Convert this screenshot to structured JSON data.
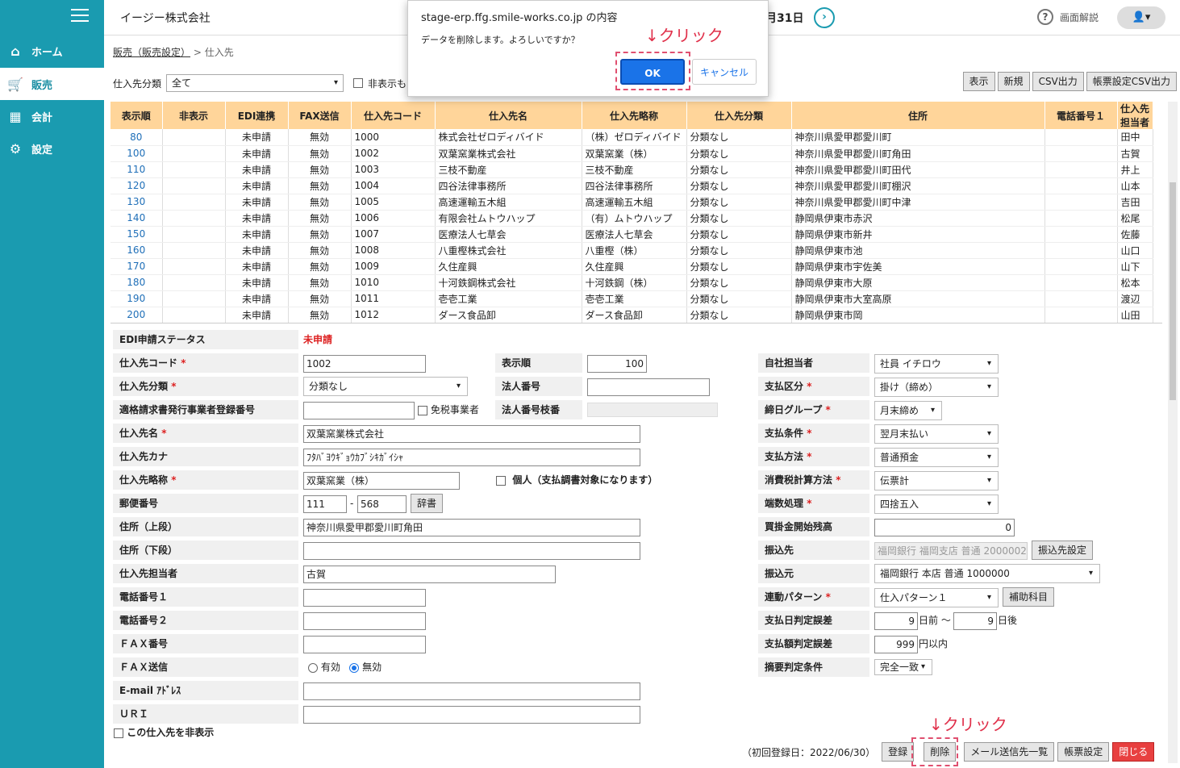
{
  "sidebar": {
    "items": [
      {
        "icon": "home-icon",
        "label": "ホーム"
      },
      {
        "icon": "cart-icon",
        "label": "販売"
      },
      {
        "icon": "calculator-icon",
        "label": "会計"
      },
      {
        "icon": "gear-icon",
        "label": "設定"
      }
    ]
  },
  "header": {
    "company": "イージー株式会社",
    "date_fragment": "月31日",
    "help_label": "画面解説"
  },
  "breadcrumb": {
    "parent": "販売（販売設定）",
    "current": "仕入先"
  },
  "filter": {
    "label": "仕入先分類",
    "value": "全て",
    "hidden_label": "非表示も"
  },
  "toolbar": {
    "show": "表示",
    "new": "新規",
    "csv": "CSV出力",
    "form_csv": "帳票設定CSV出力"
  },
  "table": {
    "headers": [
      "表示順",
      "非表示",
      "EDI連携",
      "FAX送信",
      "仕入先コード",
      "仕入先名",
      "仕入先略称",
      "仕入先分類",
      "住所",
      "電話番号１",
      "仕入先担当者"
    ],
    "rows": [
      [
        "80",
        "",
        "未申請",
        "無効",
        "1000",
        "株式会社ゼロディバイド",
        "（株）ゼロディバイド",
        "分類なし",
        "神奈川県愛甲郡愛川町",
        "",
        "田中"
      ],
      [
        "100",
        "",
        "未申請",
        "無効",
        "1002",
        "双葉窯業株式会社",
        "双葉窯業（株）",
        "分類なし",
        "神奈川県愛甲郡愛川町角田",
        "",
        "古賀"
      ],
      [
        "110",
        "",
        "未申請",
        "無効",
        "1003",
        "三枝不動産",
        "三枝不動産",
        "分類なし",
        "神奈川県愛甲郡愛川町田代",
        "",
        "井上"
      ],
      [
        "120",
        "",
        "未申請",
        "無効",
        "1004",
        "四谷法律事務所",
        "四谷法律事務所",
        "分類なし",
        "神奈川県愛甲郡愛川町棚沢",
        "",
        "山本"
      ],
      [
        "130",
        "",
        "未申請",
        "無効",
        "1005",
        "高速運輸五木組",
        "高速運輸五木組",
        "分類なし",
        "神奈川県愛甲郡愛川町中津",
        "",
        "吉田"
      ],
      [
        "140",
        "",
        "未申請",
        "無効",
        "1006",
        "有限会社ムトウハップ",
        "（有）ムトウハップ",
        "分類なし",
        "静岡県伊東市赤沢",
        "",
        "松尾"
      ],
      [
        "150",
        "",
        "未申請",
        "無効",
        "1007",
        "医療法人七草会",
        "医療法人七草会",
        "分類なし",
        "静岡県伊東市新井",
        "",
        "佐藤"
      ],
      [
        "160",
        "",
        "未申請",
        "無効",
        "1008",
        "八重樫株式会社",
        "八重樫（株）",
        "分類なし",
        "静岡県伊東市池",
        "",
        "山口"
      ],
      [
        "170",
        "",
        "未申請",
        "無効",
        "1009",
        "久住産興",
        "久住産興",
        "分類なし",
        "静岡県伊東市宇佐美",
        "",
        "山下"
      ],
      [
        "180",
        "",
        "未申請",
        "無効",
        "1010",
        "十河鉄鋼株式会社",
        "十河鉄鋼（株）",
        "分類なし",
        "静岡県伊東市大原",
        "",
        "松本"
      ],
      [
        "190",
        "",
        "未申請",
        "無効",
        "1011",
        "壱壱工業",
        "壱壱工業",
        "分類なし",
        "静岡県伊東市大室高原",
        "",
        "渡辺"
      ],
      [
        "200",
        "",
        "未申請",
        "無効",
        "1012",
        "ダース食品卸",
        "ダース食品卸",
        "分類なし",
        "静岡県伊東市岡",
        "",
        "山田"
      ]
    ]
  },
  "form": {
    "edi_label": "EDI申請ステータス",
    "edi_value": "未申請",
    "code_label": "仕入先コード",
    "code_value": "1002",
    "order_label": "表示順",
    "order_value": "100",
    "category_label": "仕入先分類",
    "category_value": "分類なし",
    "corp_label": "法人番号",
    "corp_value": "",
    "invoice_label": "適格請求書発行事業者登録番号",
    "invoice_value": "",
    "taxfree_label": "免税事業者",
    "corp_branch_label": "法人番号枝番",
    "name_label": "仕入先名",
    "name_value": "双葉窯業株式会社",
    "kana_label": "仕入先カナ",
    "kana_value": "ﾌﾀﾊﾞﾖｳｷﾞｮｳｶﾌﾞｼｷｶﾞｲｼｬ",
    "short_label": "仕入先略称",
    "short_value": "双葉窯業（株）",
    "individual_label": "個人（支払調書対象になります）",
    "zip_label": "郵便番号",
    "zip1": "111",
    "zip_sep": "-",
    "zip2": "568",
    "dict_btn": "辞書",
    "addr1_label": "住所（上段）",
    "addr1_value": "神奈川県愛甲郡愛川町角田",
    "addr2_label": "住所（下段）",
    "addr2_value": "",
    "person_label": "仕入先担当者",
    "person_value": "古賀",
    "tel1_label": "電話番号１",
    "tel2_label": "電話番号２",
    "fax_label": "ＦＡＸ番号",
    "faxsend_label": "ＦＡＸ送信",
    "fax_on": "有効",
    "fax_off": "無効",
    "email_label": "E-mail ｱﾄﾞﾚｽ",
    "uri_label": "ＵＲＩ",
    "hide_label": "この仕入先を非表示",
    "staff_label": "自社担当者",
    "staff_value": "社員 イチロウ",
    "paytype_label": "支払区分",
    "paytype_value": "掛け（締め）",
    "closing_label": "締日グループ",
    "closing_value": "月末締め",
    "payterm_label": "支払条件",
    "payterm_value": "翌月末払い",
    "paymethod_label": "支払方法",
    "paymethod_value": "普通預金",
    "taxcalc_label": "消費税計算方法",
    "taxcalc_value": "伝票計",
    "round_label": "端数処理",
    "round_value": "四捨五入",
    "opening_label": "買掛金開始残高",
    "opening_value": "0",
    "transfer_to_label": "振込先",
    "transfer_to_value": "福岡銀行 福岡支店 普通 2000002",
    "transfer_btn": "振込先設定",
    "transfer_from_label": "振込元",
    "transfer_from_value": "福岡銀行 本店 普通 1000000",
    "link_label": "連動パターン",
    "link_value": "仕入パターン１",
    "sub_btn": "補助科目",
    "day_err_label": "支払日判定誤差",
    "day_before": "9",
    "day_before_unit": "日前 〜",
    "day_after": "9",
    "day_after_unit": "日後",
    "amt_err_label": "支払額判定誤差",
    "amt_value": "999",
    "amt_unit": "円以内",
    "summary_label": "摘要判定条件",
    "summary_value": "完全一致"
  },
  "footer": {
    "registered": "（初回登録日：2022/06/30）",
    "register": "登録",
    "delete": "削除",
    "mail": "メール送信先一覧",
    "form": "帳票設定",
    "close": "閉じる"
  },
  "dialog": {
    "title": "stage-erp.ffg.smile-works.co.jp の内容",
    "message": "データを削除します。よろしいですか？",
    "ok": "OK",
    "cancel": "キャンセル"
  },
  "annotations": {
    "click1": "↓クリック",
    "click2": "↓クリック"
  }
}
